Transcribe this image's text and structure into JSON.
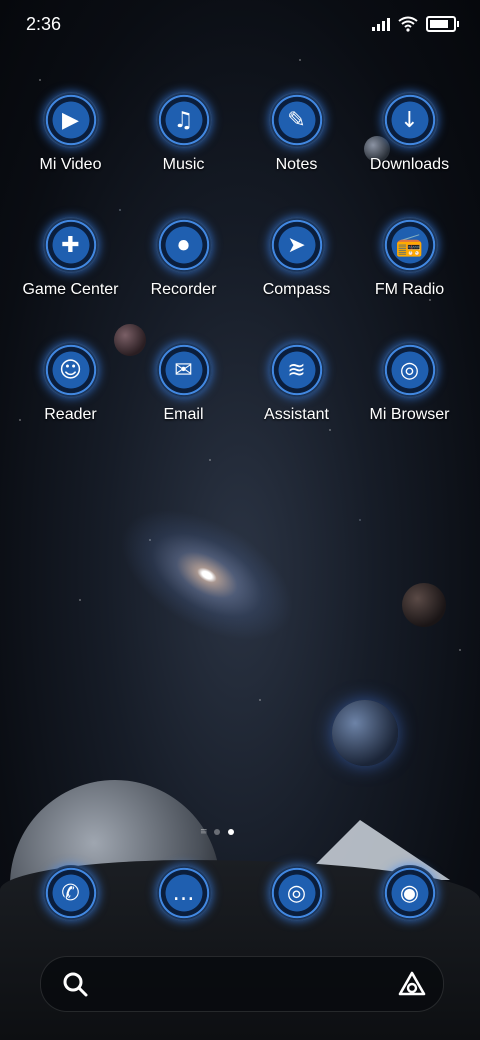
{
  "status_bar": {
    "time": "2:36",
    "battery_level": 0.9
  },
  "home_grid": [
    {
      "label": "Mi Video",
      "icon": "tv-play-icon",
      "glyph": "▶"
    },
    {
      "label": "Music",
      "icon": "music-note-icon",
      "glyph": "♫"
    },
    {
      "label": "Notes",
      "icon": "notepad-icon",
      "glyph": "✎"
    },
    {
      "label": "Downloads",
      "icon": "download-arrow-icon",
      "glyph": "↓"
    },
    {
      "label": "Game Center",
      "icon": "gamepad-icon",
      "glyph": "✚"
    },
    {
      "label": "Recorder",
      "icon": "radio-recorder-icon",
      "glyph": "⏺"
    },
    {
      "label": "Compass",
      "icon": "compass-icon",
      "glyph": "➤"
    },
    {
      "label": "FM Radio",
      "icon": "radio-icon",
      "glyph": "📻"
    },
    {
      "label": "Reader",
      "icon": "smile-face-icon",
      "glyph": "☺"
    },
    {
      "label": "Email",
      "icon": "envelope-icon",
      "glyph": "✉"
    },
    {
      "label": "Assistant",
      "icon": "voice-wave-icon",
      "glyph": "≋"
    },
    {
      "label": "Mi Browser",
      "icon": "chrome-browser-icon",
      "glyph": "◎"
    }
  ],
  "dock": [
    {
      "icon": "phone-icon",
      "glyph": "✆"
    },
    {
      "icon": "chat-bubble-icon",
      "glyph": "…"
    },
    {
      "icon": "chrome-browser-icon",
      "glyph": "◎"
    },
    {
      "icon": "camera-icon",
      "glyph": "◉"
    }
  ],
  "page_indicator": {
    "pages": 2,
    "active": 2
  },
  "search": {
    "left_icon": "search-icon",
    "right_icon": "assistant-triangle-icon"
  }
}
